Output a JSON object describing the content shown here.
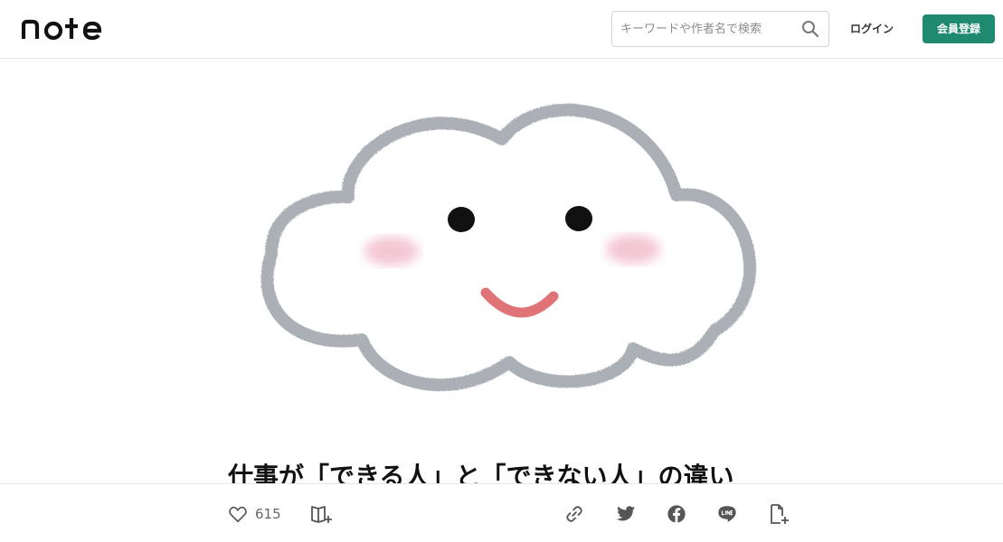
{
  "header": {
    "logo_text": "note",
    "search": {
      "placeholder": "キーワードや作者名で検索",
      "value": ""
    },
    "login_label": "ログイン",
    "signup_label": "会員登録",
    "signup_color": "#1f8a70"
  },
  "hero": {
    "image": "cloud-with-smiling-face",
    "colors": {
      "outline": "#aab0b6",
      "cheek": "#f4c6d4",
      "mouth": "#e07378",
      "eye": "#111111"
    }
  },
  "article": {
    "title": "仕事が「できる人」と「できない人」の違い"
  },
  "actions": {
    "like_count": "615",
    "icons": [
      "heart-icon",
      "magazine-add-icon",
      "link-icon",
      "twitter-icon",
      "facebook-icon",
      "line-icon",
      "embed-icon"
    ]
  }
}
